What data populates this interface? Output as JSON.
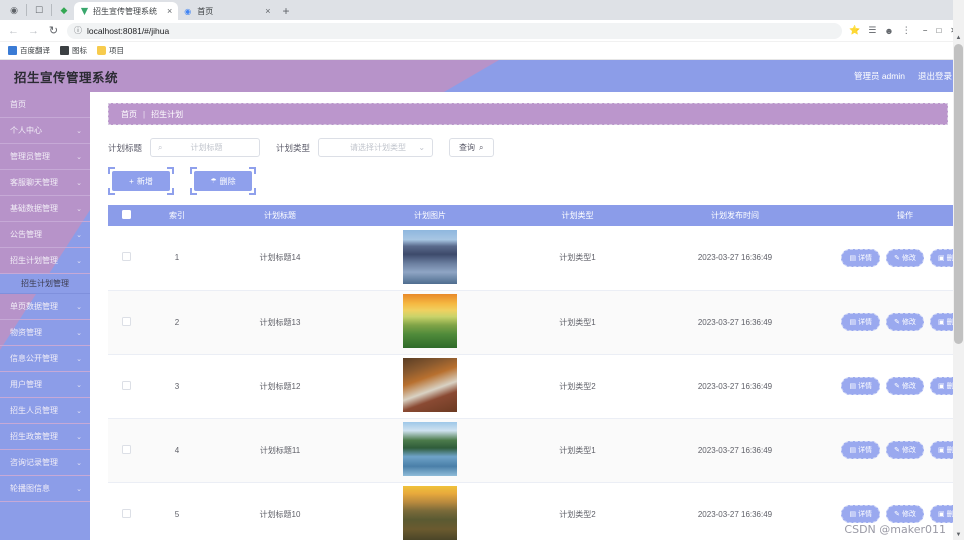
{
  "browser": {
    "tabs": [
      {
        "title": "招生宣传管理系统",
        "active": true,
        "close": "×"
      },
      {
        "title": "首页",
        "active": false,
        "close": "×"
      }
    ],
    "new_tab": "+",
    "nav": {
      "back": "←",
      "forward": "→",
      "reload": "↻"
    },
    "omnibox": {
      "value": "localhost:8081/#/jihua",
      "info_icon": "ⓘ"
    },
    "toolbar_right": [
      "⭐",
      "☰",
      "⋮"
    ],
    "window_controls": [
      "−",
      "□",
      "✕"
    ],
    "bookmarks": [
      {
        "label": "百度翻译",
        "icon": "blue"
      },
      {
        "label": "图标",
        "icon": "dark"
      },
      {
        "label": "项目",
        "icon": "folder"
      }
    ]
  },
  "app": {
    "title": "招生宣传管理系统",
    "user_label": "管理员 admin",
    "logout_label": "退出登录",
    "colors": {
      "purple": "#b793c9",
      "blue": "#8c9de8",
      "table_header": "#8b9ce9",
      "button": "#8fa0ec"
    }
  },
  "sidebar": {
    "items": [
      {
        "label": "首页",
        "caret": ""
      },
      {
        "label": "个人中心",
        "caret": "⌄"
      },
      {
        "label": "管理员管理",
        "caret": "⌄"
      },
      {
        "label": "客服聊天管理",
        "caret": "⌄"
      },
      {
        "label": "基础数据管理",
        "caret": "⌄"
      },
      {
        "label": "公告管理",
        "caret": "⌄"
      },
      {
        "label": "招生计划管理",
        "caret": "⌄"
      }
    ],
    "active_submenu": "招生计划管理",
    "items_after": [
      {
        "label": "单页数据管理",
        "caret": "⌄"
      },
      {
        "label": "物资管理",
        "caret": "⌄"
      },
      {
        "label": "信息公开管理",
        "caret": "⌄"
      },
      {
        "label": "用户管理",
        "caret": "⌄"
      },
      {
        "label": "招生人员管理",
        "caret": "⌄"
      },
      {
        "label": "招生政策管理",
        "caret": "⌄"
      },
      {
        "label": "咨询记录管理",
        "caret": "⌄"
      },
      {
        "label": "轮播图信息",
        "caret": "⌄"
      }
    ]
  },
  "breadcrumb": {
    "home": "首页",
    "sep": "|",
    "current": "招生计划"
  },
  "search": {
    "title_label": "计划标题",
    "title_placeholder": "计划标题",
    "title_value": "",
    "search_icon": "⌕",
    "type_label": "计划类型",
    "type_placeholder": "请选择计划类型",
    "type_caret": "⌄",
    "query_label": "查询",
    "query_icon": "⌕"
  },
  "actions": {
    "add_label": "新增",
    "add_icon": "+",
    "delete_label": "删除",
    "delete_icon": "Ὕ1"
  },
  "table": {
    "columns": [
      "索引",
      "计划标题",
      "计划图片",
      "计划类型",
      "计划发布时间",
      "操作"
    ],
    "row_ops": [
      {
        "label": "详情",
        "icon": "▤"
      },
      {
        "label": "修改",
        "icon": "✎"
      },
      {
        "label": "删除",
        "icon": "▣"
      }
    ],
    "rows": [
      {
        "index": "1",
        "title": "计划标题14",
        "type": "计划类型1",
        "time": "2023-03-27 16:36:49",
        "image": "city-mountain"
      },
      {
        "index": "2",
        "title": "计划标题13",
        "type": "计划类型1",
        "time": "2023-03-27 16:36:49",
        "image": "sunset-field"
      },
      {
        "index": "3",
        "title": "计划标题12",
        "type": "计划类型2",
        "time": "2023-03-27 16:36:49",
        "image": "corridor"
      },
      {
        "index": "4",
        "title": "计划标题11",
        "type": "计划类型1",
        "time": "2023-03-27 16:36:49",
        "image": "lake-reflection"
      },
      {
        "index": "5",
        "title": "计划标题10",
        "type": "计划类型2",
        "time": "2023-03-27 16:36:49",
        "image": "mountain-sunrise"
      }
    ]
  },
  "watermark": "CSDN @maker011"
}
